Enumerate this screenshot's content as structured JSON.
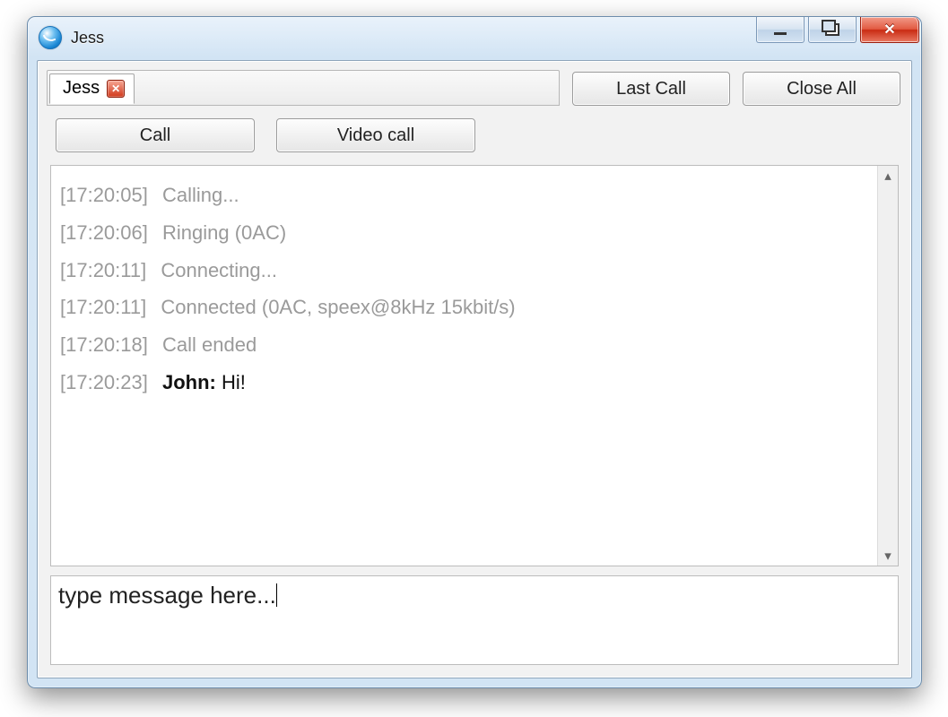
{
  "window": {
    "title": "Jess"
  },
  "tabs": {
    "items": [
      {
        "label": "Jess"
      }
    ]
  },
  "header_buttons": {
    "last_call": "Last Call",
    "close_all": "Close All"
  },
  "actions": {
    "call": "Call",
    "video_call": "Video call"
  },
  "log": [
    {
      "ts": "[17:20:05]",
      "kind": "status",
      "text": "Calling..."
    },
    {
      "ts": "[17:20:06]",
      "kind": "status",
      "text": "Ringing (0AC)"
    },
    {
      "ts": "[17:20:11]",
      "kind": "status",
      "text": "Connecting..."
    },
    {
      "ts": "[17:20:11]",
      "kind": "status",
      "text": "Connected (0AC, speex@8kHz 15kbit/s)"
    },
    {
      "ts": "[17:20:18]",
      "kind": "status",
      "text": "Call ended"
    },
    {
      "ts": "[17:20:23]",
      "kind": "message",
      "sender": "John:",
      "text": "Hi!"
    }
  ],
  "input": {
    "value": "type message here...",
    "placeholder": ""
  }
}
